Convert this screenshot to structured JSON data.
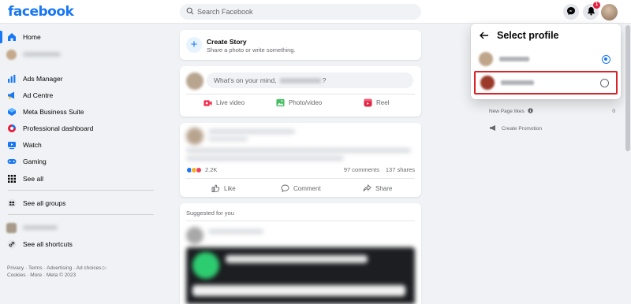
{
  "header": {
    "logo": "facebook",
    "search_placeholder": "Search Facebook",
    "notification_count": "1"
  },
  "sidebar": {
    "items": [
      {
        "label": "Home",
        "icon": "home-icon"
      },
      {
        "label": "Ads Manager",
        "icon": "bar-chart-icon"
      },
      {
        "label": "Ad Centre",
        "icon": "megaphone-icon"
      },
      {
        "label": "Meta Business Suite",
        "icon": "business-suite-icon"
      },
      {
        "label": "Professional dashboard",
        "icon": "dashboard-icon"
      },
      {
        "label": "Watch",
        "icon": "watch-icon"
      },
      {
        "label": "Gaming",
        "icon": "gaming-icon"
      },
      {
        "label": "See all",
        "icon": "grid-icon"
      },
      {
        "label": "See all groups",
        "icon": "groups-icon"
      },
      {
        "label": "See all shortcuts",
        "icon": "link-icon"
      }
    ],
    "footer_line1": "Privacy · Terms · Advertising · Ad choices ▷",
    "footer_line2": "Cookies · More · Meta © 2023"
  },
  "create_story": {
    "title": "Create Story",
    "subtitle": "Share a photo or write something."
  },
  "composer": {
    "prompt_prefix": "What's on your mind,",
    "prompt_suffix": "?",
    "actions": [
      {
        "label": "Live video",
        "color": "#f02849"
      },
      {
        "label": "Photo/video",
        "color": "#45bd62"
      },
      {
        "label": "Reel",
        "color": "#e42645"
      }
    ]
  },
  "post": {
    "reactions_count": "2.2K",
    "comments": "97 comments",
    "shares": "137 shares",
    "actions": [
      "Like",
      "Comment",
      "Share"
    ]
  },
  "suggested": {
    "label": "Suggested for you"
  },
  "right_panel": {
    "new_page_likes_label": "New Page likes",
    "new_page_likes_value": "0",
    "create_promotion": "Create Promotion"
  },
  "profile_menu": {
    "title": "Select profile",
    "profiles": [
      {
        "selected": true
      },
      {
        "selected": false,
        "highlighted": true
      }
    ]
  },
  "colors": {
    "brand": "#1877f2",
    "highlight": "#d9252a",
    "background": "#f0f2f5"
  }
}
